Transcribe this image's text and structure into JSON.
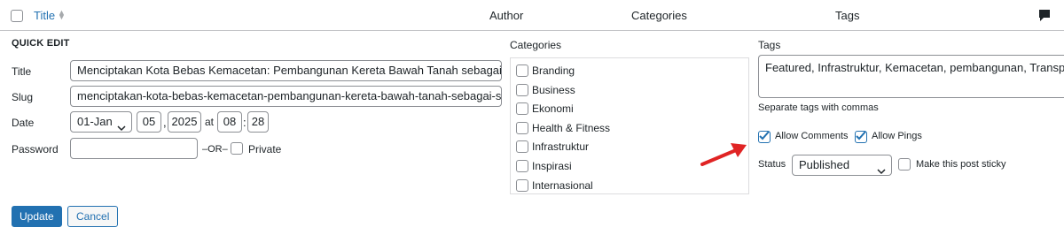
{
  "header": {
    "title_label": "Title",
    "author_label": "Author",
    "categories_label": "Categories",
    "tags_label": "Tags",
    "comments_icon": "comment-bubble-icon",
    "sort_icon": "sort-arrows-icon"
  },
  "quick_edit": {
    "heading": "QUICK EDIT",
    "title_label": "Title",
    "title_value": "Menciptakan Kota Bebas Kemacetan: Pembangunan Kereta Bawah Tanah sebagai Solusi",
    "slug_label": "Slug",
    "slug_value": "menciptakan-kota-bebas-kemacetan-pembangunan-kereta-bawah-tanah-sebagai-solusi",
    "date_label": "Date",
    "month_value": "01-Jan",
    "day_value": "05",
    "year_value": "2025",
    "at_label": "at",
    "hour_value": "08",
    "time_sep": ":",
    "minute_value": "28",
    "comma": ",",
    "password_label": "Password",
    "password_value": "",
    "or_label": "–OR–",
    "private_label": "Private",
    "private_checked": false
  },
  "categories": {
    "heading": "Categories",
    "items": [
      {
        "label": "Branding",
        "checked": false
      },
      {
        "label": "Business",
        "checked": false
      },
      {
        "label": "Ekonomi",
        "checked": false
      },
      {
        "label": "Health & Fitness",
        "checked": false
      },
      {
        "label": "Infrastruktur",
        "checked": false
      },
      {
        "label": "Inspirasi",
        "checked": false
      },
      {
        "label": "Internasional",
        "checked": false
      }
    ]
  },
  "tags": {
    "heading": "Tags",
    "value": "Featured, Infrastruktur, Kemacetan, pembangunan, Transportasi",
    "hint": "Separate tags with commas",
    "allow_comments_label": "Allow Comments",
    "allow_comments_checked": true,
    "allow_pings_label": "Allow Pings",
    "allow_pings_checked": true,
    "status_label": "Status",
    "status_value": "Published",
    "sticky_label": "Make this post sticky",
    "sticky_checked": false
  },
  "buttons": {
    "update": "Update",
    "cancel": "Cancel"
  },
  "colors": {
    "accent": "#2271b1",
    "annotation_arrow": "#e02424"
  }
}
